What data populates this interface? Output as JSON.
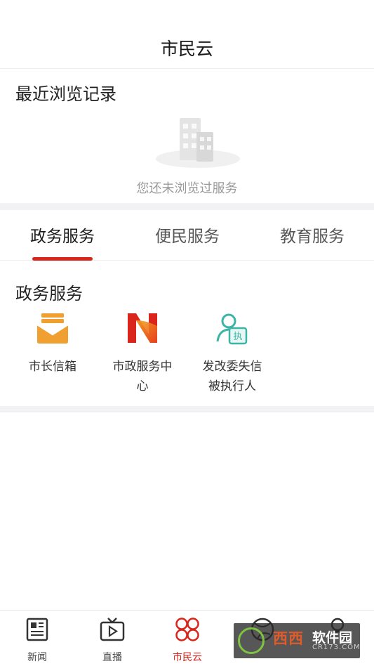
{
  "header": {
    "title": "市民云"
  },
  "recent": {
    "title": "最近浏览记录",
    "empty_text": "您还未浏览过服务"
  },
  "tabs": [
    {
      "label": "政务服务",
      "active": true
    },
    {
      "label": "便民服务",
      "active": false
    },
    {
      "label": "教育服务",
      "active": false
    }
  ],
  "services": {
    "title": "政务服务",
    "items": [
      {
        "label": "市长信箱",
        "icon": "envelope-icon"
      },
      {
        "label": "市政服务中心",
        "icon": "m-logo-icon"
      },
      {
        "label": "发改委失信被执行人",
        "icon": "person-badge-icon"
      }
    ]
  },
  "tabbar": [
    {
      "label": "新闻",
      "icon": "newspaper-icon",
      "active": false
    },
    {
      "label": "直播",
      "icon": "tv-play-icon",
      "active": false
    },
    {
      "label": "市民云",
      "icon": "clover-icon",
      "active": true
    },
    {
      "label": "",
      "icon": "globe-icon",
      "active": false
    },
    {
      "label": "",
      "icon": "user-icon",
      "active": false
    }
  ],
  "watermark": {
    "brand": "西西",
    "name": "软件园",
    "url": "CR173.COM"
  },
  "colors": {
    "accent": "#d9251c",
    "envelope": "#f0a030",
    "badge": "#3bb6a6"
  }
}
